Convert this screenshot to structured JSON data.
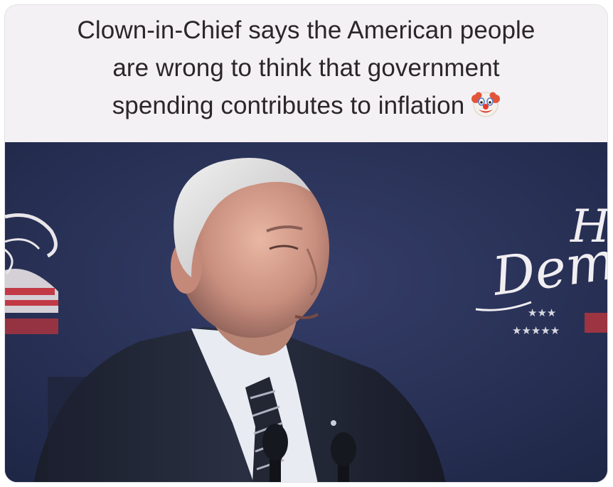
{
  "caption": {
    "line1": "Clown-in-Chief says the American people",
    "line2": "are wrong to think that government",
    "line3": "spending contributes to inflation",
    "emoji": "clown-face-emoji"
  },
  "video": {
    "backdrop_script_text": "Dem",
    "backdrop_script_initial": "H"
  },
  "colors": {
    "caption_bg": "#f3f1f3",
    "caption_text": "#2b2629",
    "backdrop": "#2b3358",
    "suit": "#202533",
    "shirt": "#e8ecf2"
  }
}
